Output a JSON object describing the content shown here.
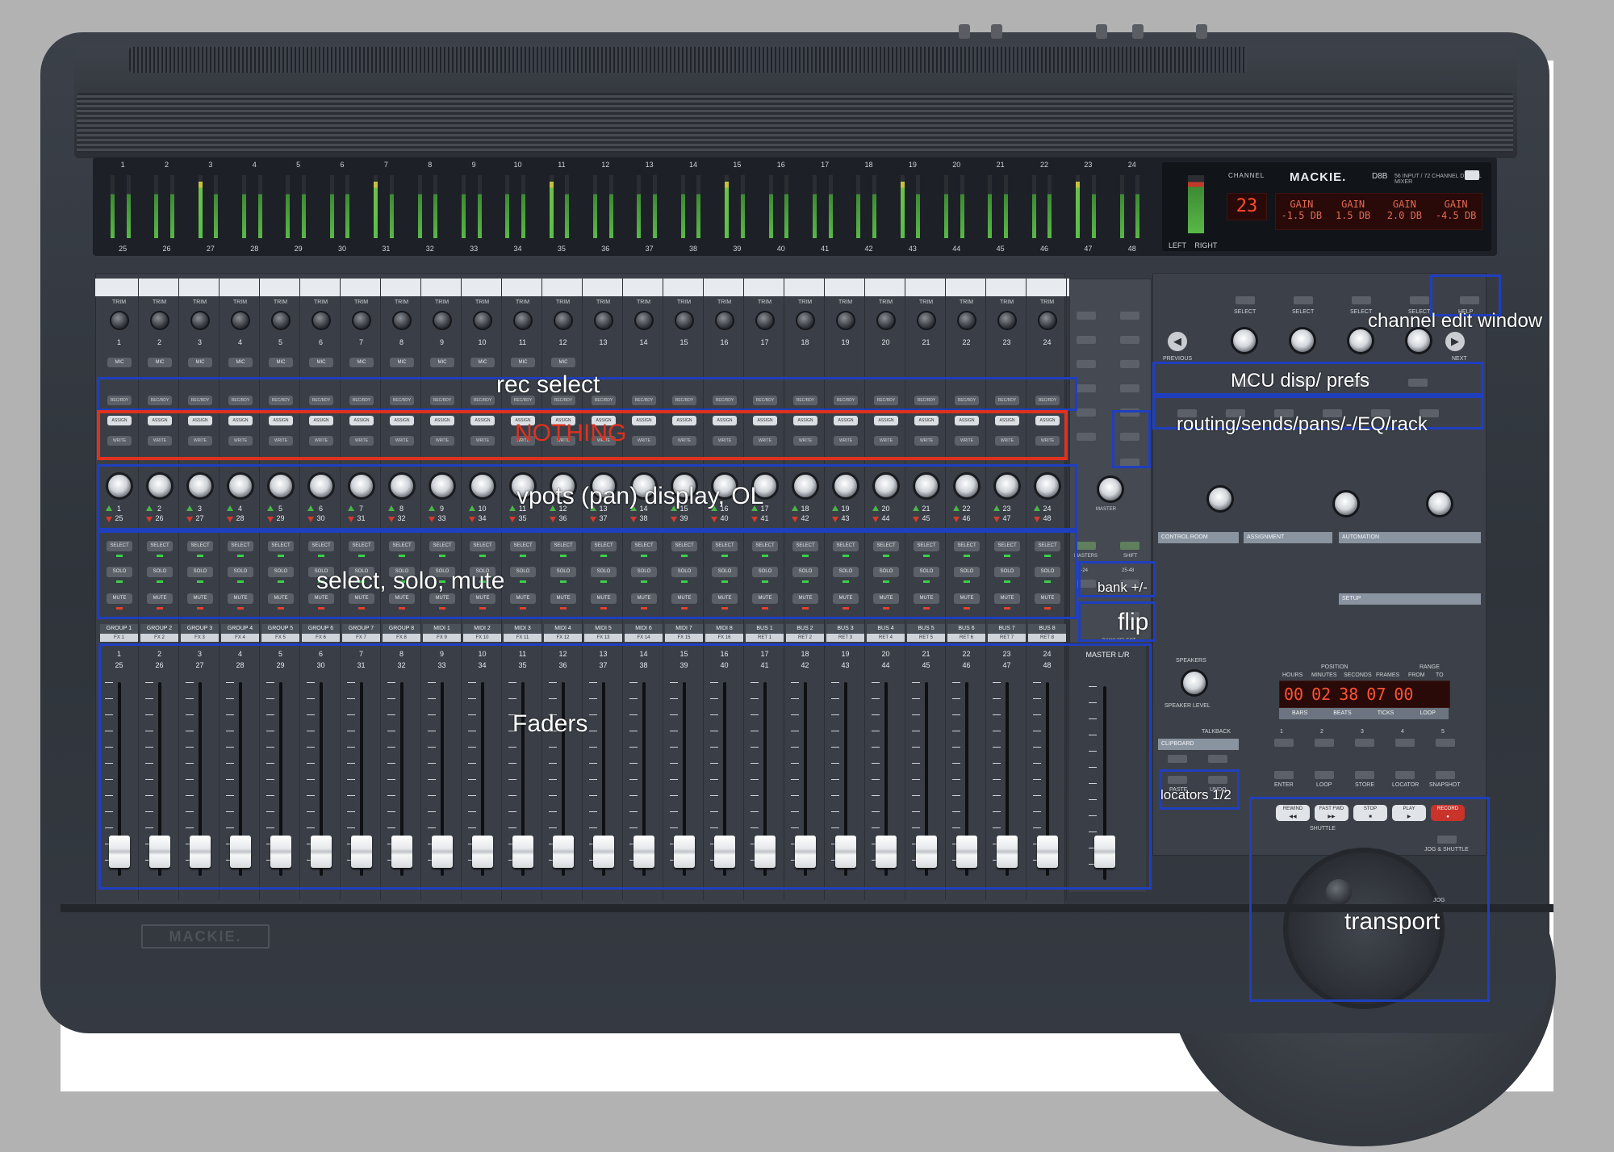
{
  "meter_bridge": {
    "channels_top": [
      "1",
      "2",
      "3",
      "4",
      "5",
      "6",
      "7",
      "8",
      "9",
      "10",
      "11",
      "12",
      "13",
      "14",
      "15",
      "16",
      "17",
      "18",
      "19",
      "20",
      "21",
      "22",
      "23",
      "24"
    ],
    "channels_bottom": [
      "25",
      "26",
      "27",
      "28",
      "29",
      "30",
      "31",
      "32",
      "33",
      "34",
      "35",
      "36",
      "37",
      "38",
      "39",
      "40",
      "41",
      "42",
      "43",
      "44",
      "45",
      "46",
      "47",
      "48"
    ],
    "lr_label": "LEFT RIGHT",
    "channel_label": "CHANNEL",
    "channel_number": "23",
    "brand": "MACKIE.",
    "model": "D8B",
    "model_sub": "56 INPUT / 72 CHANNEL DIGITAL MIXER",
    "gains": [
      {
        "label": "GAIN",
        "value": "-1.5 DB"
      },
      {
        "label": "GAIN",
        "value": "1.5 DB"
      },
      {
        "label": "GAIN",
        "value": "2.0 DB"
      },
      {
        "label": "GAIN",
        "value": "-4.5 DB"
      }
    ]
  },
  "strip_labels": {
    "trim": "TRIM",
    "mic": "MIC",
    "rec": "REC/RDY",
    "assign": "ASSIGN",
    "write": "WRITE",
    "select": "SELECT",
    "solo": "SOLO",
    "mute": "MUTE"
  },
  "strips": [
    {
      "top": "1",
      "bottom": "25",
      "group": "GROUP 1",
      "fx": "FX 1",
      "mic": true
    },
    {
      "top": "2",
      "bottom": "26",
      "group": "GROUP 2",
      "fx": "FX 2",
      "mic": true
    },
    {
      "top": "3",
      "bottom": "27",
      "group": "GROUP 3",
      "fx": "FX 3",
      "mic": true
    },
    {
      "top": "4",
      "bottom": "28",
      "group": "GROUP 4",
      "fx": "FX 4",
      "mic": true
    },
    {
      "top": "5",
      "bottom": "29",
      "group": "GROUP 5",
      "fx": "FX 5",
      "mic": true
    },
    {
      "top": "6",
      "bottom": "30",
      "group": "GROUP 6",
      "fx": "FX 6",
      "mic": true
    },
    {
      "top": "7",
      "bottom": "31",
      "group": "GROUP 7",
      "fx": "FX 7",
      "mic": true
    },
    {
      "top": "8",
      "bottom": "32",
      "group": "GROUP 8",
      "fx": "FX 8",
      "mic": true
    },
    {
      "top": "9",
      "bottom": "33",
      "group": "MIDI 1",
      "fx": "FX 9",
      "mic": true
    },
    {
      "top": "10",
      "bottom": "34",
      "group": "MIDI 2",
      "fx": "FX 10",
      "mic": true
    },
    {
      "top": "11",
      "bottom": "35",
      "group": "MIDI 3",
      "fx": "FX 11",
      "mic": true
    },
    {
      "top": "12",
      "bottom": "36",
      "group": "MIDI 4",
      "fx": "FX 12",
      "mic": true
    },
    {
      "top": "13",
      "bottom": "37",
      "group": "MIDI 5",
      "fx": "FX 13",
      "mic": false
    },
    {
      "top": "14",
      "bottom": "38",
      "group": "MIDI 6",
      "fx": "FX 14",
      "mic": false
    },
    {
      "top": "15",
      "bottom": "39",
      "group": "MIDI 7",
      "fx": "FX 15",
      "mic": false
    },
    {
      "top": "16",
      "bottom": "40",
      "group": "MIDI 8",
      "fx": "FX 16",
      "mic": false
    },
    {
      "top": "17",
      "bottom": "41",
      "group": "BUS 1",
      "fx": "RET 1",
      "mic": false
    },
    {
      "top": "18",
      "bottom": "42",
      "group": "BUS 2",
      "fx": "RET 2",
      "mic": false
    },
    {
      "top": "19",
      "bottom": "43",
      "group": "BUS 3",
      "fx": "RET 3",
      "mic": false
    },
    {
      "top": "20",
      "bottom": "44",
      "group": "BUS 4",
      "fx": "RET 4",
      "mic": false
    },
    {
      "top": "21",
      "bottom": "45",
      "group": "BUS 5",
      "fx": "RET 5",
      "mic": false
    },
    {
      "top": "22",
      "bottom": "46",
      "group": "BUS 6",
      "fx": "RET 6",
      "mic": false
    },
    {
      "top": "23",
      "bottom": "47",
      "group": "BUS 7",
      "fx": "RET 7",
      "mic": false
    },
    {
      "top": "24",
      "bottom": "48",
      "group": "BUS 8",
      "fx": "RET 8",
      "mic": false
    }
  ],
  "master": {
    "label": "MASTER L/R"
  },
  "center": {
    "masters": "MASTERS",
    "shift": "SHIFT",
    "master_knob": "MASTER",
    "bank_a": "1-24",
    "bank_b": "25-48",
    "bank_select": "BANK SELECT"
  },
  "right_panel": {
    "select_labels": [
      "SELECT",
      "SELECT",
      "SELECT",
      "SELECT"
    ],
    "help": "HELP",
    "prev": "PREVIOUS",
    "next": "NEXT",
    "sections": [
      "CONTROL ROOM",
      "ASSIGNMENT",
      "AUTOMATION",
      "SETUP",
      "SPEAKERS",
      "CLIPBOARD"
    ],
    "speaker_level": "SPEAKER LEVEL",
    "talkback": "TALKBACK",
    "position_label": "POSITION",
    "range_label": "RANGE",
    "time_cols": [
      "HOURS",
      "MINUTES",
      "SECONDS",
      "FRAMES"
    ],
    "range_cols": [
      "FROM",
      "TO"
    ],
    "time_digits": [
      "00",
      "02",
      "38",
      "07"
    ],
    "range_digits": [
      "00"
    ],
    "time_units": [
      "BARS",
      "BEATS",
      "TICKS",
      "LOOP"
    ],
    "locator_numbers": [
      "1",
      "2",
      "3",
      "4",
      "5"
    ],
    "locator_functions": [
      "ENTER",
      "LOOP",
      "STORE",
      "LOCATOR",
      "SNAPSHOT"
    ],
    "clip_buttons": [
      "PASTE",
      "UNDO"
    ],
    "transport": [
      {
        "label": "REWIND",
        "glyph": "◀◀"
      },
      {
        "label": "FAST FWD",
        "glyph": "▶▶"
      },
      {
        "label": "STOP",
        "glyph": "■"
      },
      {
        "label": "PLAY",
        "glyph": "▶"
      },
      {
        "label": "RECORD",
        "glyph": "●"
      }
    ],
    "shuttle": "SHUTTLE",
    "jog_shuttle": "JOG & SHUTTLE",
    "jog": "JOG"
  },
  "bottom_logo": "MACKIE.",
  "annotations": {
    "rec_select": "rec select",
    "nothing": "NOTHING",
    "vpots": "vpots (pan) display, OL",
    "select_solo_mute": "select, solo, mute",
    "faders": "Faders",
    "channel_edit": "channel edit window",
    "mcu_disp": "MCU disp/ prefs",
    "routing": "routing/sends/pans/-/EQ/rack",
    "bank": "bank +/-",
    "flip": "flip",
    "locators": "locators 1/2",
    "transport": "transport"
  },
  "colors": {
    "annotation_blue": "#1f3fbf",
    "annotation_red": "#e0311f",
    "console": "#34393f",
    "lcd_red": "#ff4c2c",
    "meter_green": "#59b847"
  }
}
